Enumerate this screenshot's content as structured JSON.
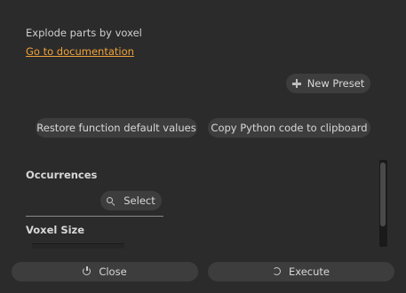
{
  "header": {
    "description": "Explode parts by voxel",
    "doc_link": "Go to documentation"
  },
  "toolbar": {
    "new_preset_label": "New Preset",
    "restore_label": "Restore function default values",
    "copy_label": "Copy Python code to clipboard"
  },
  "params": {
    "occurrences_title": "Occurrences",
    "select_label": "Select",
    "voxel_title": "Voxel Size"
  },
  "footer": {
    "close_label": "Close",
    "execute_label": "Execute"
  },
  "colors": {
    "background": "#2b2b2b",
    "button": "#3d3d3d",
    "link": "#f0a23a"
  }
}
